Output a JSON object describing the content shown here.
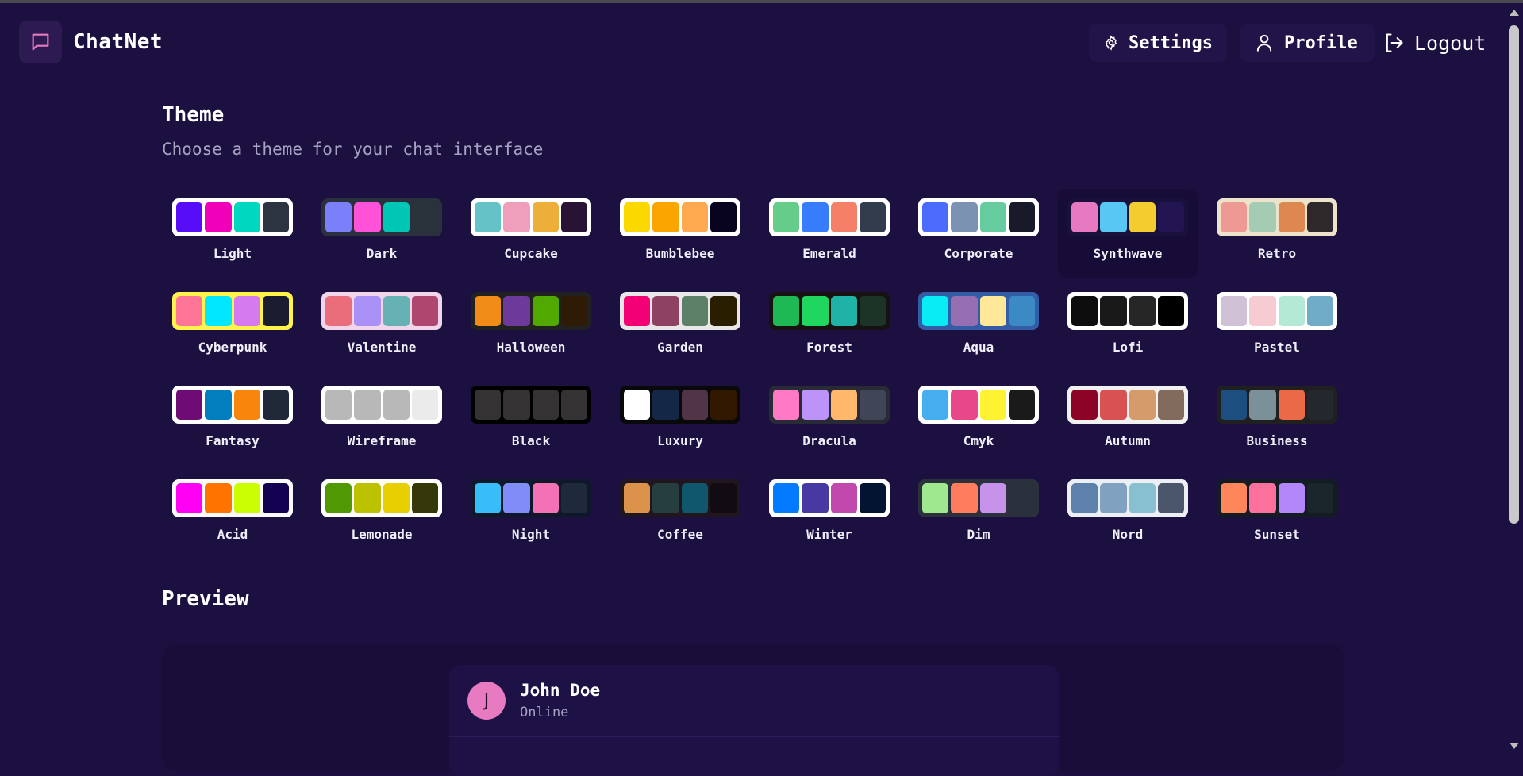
{
  "app": {
    "brand": "ChatNet",
    "logo_icon": "chat-bubble-icon",
    "accent": "#e87ac2"
  },
  "nav": {
    "settings_label": "Settings",
    "profile_label": "Profile",
    "logout_label": "Logout"
  },
  "theme_section": {
    "title": "Theme",
    "subtitle": "Choose a theme for your chat interface",
    "selected": "Synthwave",
    "themes": [
      {
        "name": "Light",
        "frame": "#ffffff",
        "colors": [
          "#570df8",
          "#f000b8",
          "#00d7c0",
          "#2b3440"
        ]
      },
      {
        "name": "Dark",
        "frame": "#2a303c",
        "colors": [
          "#7b7ffa",
          "#ff52d9",
          "#00c7b5",
          "#2a323c"
        ]
      },
      {
        "name": "Cupcake",
        "frame": "#ffffff",
        "colors": [
          "#65c3c8",
          "#ef9fbc",
          "#eeaf3a",
          "#291334"
        ]
      },
      {
        "name": "Bumblebee",
        "frame": "#ffffff",
        "colors": [
          "#fad800",
          "#fba500",
          "#ffa950",
          "#080420"
        ]
      },
      {
        "name": "Emerald",
        "frame": "#ffffff",
        "colors": [
          "#66cc8a",
          "#377cfb",
          "#f68067",
          "#333c4d"
        ]
      },
      {
        "name": "Corporate",
        "frame": "#ffffff",
        "colors": [
          "#4b6bfb",
          "#7b92b2",
          "#67cba0",
          "#181a2a"
        ]
      },
      {
        "name": "Synthwave",
        "frame": "#1a103d",
        "colors": [
          "#e779c1",
          "#58c7f3",
          "#f3cc30",
          "#221551"
        ]
      },
      {
        "name": "Retro",
        "frame": "#ece3ca",
        "colors": [
          "#ef9995",
          "#a4cbb4",
          "#dc8850",
          "#2e282a"
        ]
      },
      {
        "name": "Cyberpunk",
        "frame": "#fff248",
        "colors": [
          "#ff7598",
          "#00e7ff",
          "#d67af0",
          "#1a1d30"
        ]
      },
      {
        "name": "Valentine",
        "frame": "#f0d6e8",
        "colors": [
          "#e96d7b",
          "#a991f7",
          "#66b1b3",
          "#af4670"
        ]
      },
      {
        "name": "Halloween",
        "frame": "#212121",
        "colors": [
          "#f28c18",
          "#6d3a9c",
          "#51a800",
          "#2f1b05"
        ]
      },
      {
        "name": "Garden",
        "frame": "#e9e7e7",
        "colors": [
          "#f40076",
          "#8e4162",
          "#5c7f67",
          "#291e00"
        ]
      },
      {
        "name": "Forest",
        "frame": "#171212",
        "colors": [
          "#1eb854",
          "#1fd65f",
          "#1fb2a6",
          "#1c3427"
        ]
      },
      {
        "name": "Aqua",
        "frame": "#345da7",
        "colors": [
          "#09ecf3",
          "#966fb3",
          "#ffe999",
          "#3b8ac4"
        ]
      },
      {
        "name": "Lofi",
        "frame": "#ffffff",
        "colors": [
          "#0d0d0d",
          "#1a1919",
          "#262626",
          "#000000"
        ]
      },
      {
        "name": "Pastel",
        "frame": "#ffffff",
        "colors": [
          "#d1c1d7",
          "#f6cbd1",
          "#b4e9d6",
          "#70acc7"
        ]
      },
      {
        "name": "Fantasy",
        "frame": "#ffffff",
        "colors": [
          "#6e0b75",
          "#007ebd",
          "#f8860d",
          "#1f2937"
        ]
      },
      {
        "name": "Wireframe",
        "frame": "#ffffff",
        "colors": [
          "#b8b8b8",
          "#b8b8b8",
          "#b8b8b8",
          "#ebebeb"
        ]
      },
      {
        "name": "Black",
        "frame": "#000000",
        "colors": [
          "#343232",
          "#343232",
          "#343232",
          "#343232"
        ]
      },
      {
        "name": "Luxury",
        "frame": "#09090b",
        "colors": [
          "#ffffff",
          "#152747",
          "#513448",
          "#331800"
        ]
      },
      {
        "name": "Dracula",
        "frame": "#282a36",
        "colors": [
          "#ff79c6",
          "#bd93f9",
          "#ffb86c",
          "#414558"
        ]
      },
      {
        "name": "Cmyk",
        "frame": "#ffffff",
        "colors": [
          "#45aeee",
          "#e8488a",
          "#fff232",
          "#1a1a1a"
        ]
      },
      {
        "name": "Autumn",
        "frame": "#f1f1f1",
        "colors": [
          "#8c0327",
          "#d85251",
          "#d59b6a",
          "#826a5c"
        ]
      },
      {
        "name": "Business",
        "frame": "#202020",
        "colors": [
          "#1c4e80",
          "#7c909a",
          "#ea6947",
          "#23282e"
        ]
      },
      {
        "name": "Acid",
        "frame": "#fafafa",
        "colors": [
          "#ff00f4",
          "#ff7400",
          "#cbfd03",
          "#140152"
        ]
      },
      {
        "name": "Lemonade",
        "frame": "#ffffff",
        "colors": [
          "#519903",
          "#bcc200",
          "#e8d000",
          "#353809"
        ]
      },
      {
        "name": "Night",
        "frame": "#0f172a",
        "colors": [
          "#38bdf8",
          "#818cf8",
          "#f471b5",
          "#1e293b"
        ]
      },
      {
        "name": "Coffee",
        "frame": "#20161f",
        "colors": [
          "#db924b",
          "#263e3f",
          "#10576d",
          "#120c12"
        ]
      },
      {
        "name": "Winter",
        "frame": "#ffffff",
        "colors": [
          "#047aff",
          "#463aa2",
          "#c148ac",
          "#021431"
        ]
      },
      {
        "name": "Dim",
        "frame": "#2a303c",
        "colors": [
          "#9fe88d",
          "#ff7d5c",
          "#c792e9",
          "#2a303c"
        ]
      },
      {
        "name": "Nord",
        "frame": "#eceff4",
        "colors": [
          "#5e81ac",
          "#81a1c1",
          "#88c0d0",
          "#4c566a"
        ]
      },
      {
        "name": "Sunset",
        "frame": "#121c22",
        "colors": [
          "#ff865b",
          "#fd6f9c",
          "#b387fa",
          "#1b262c"
        ]
      }
    ]
  },
  "preview": {
    "title": "Preview",
    "contact_name": "John Doe",
    "contact_initial": "J",
    "contact_status": "Online"
  }
}
